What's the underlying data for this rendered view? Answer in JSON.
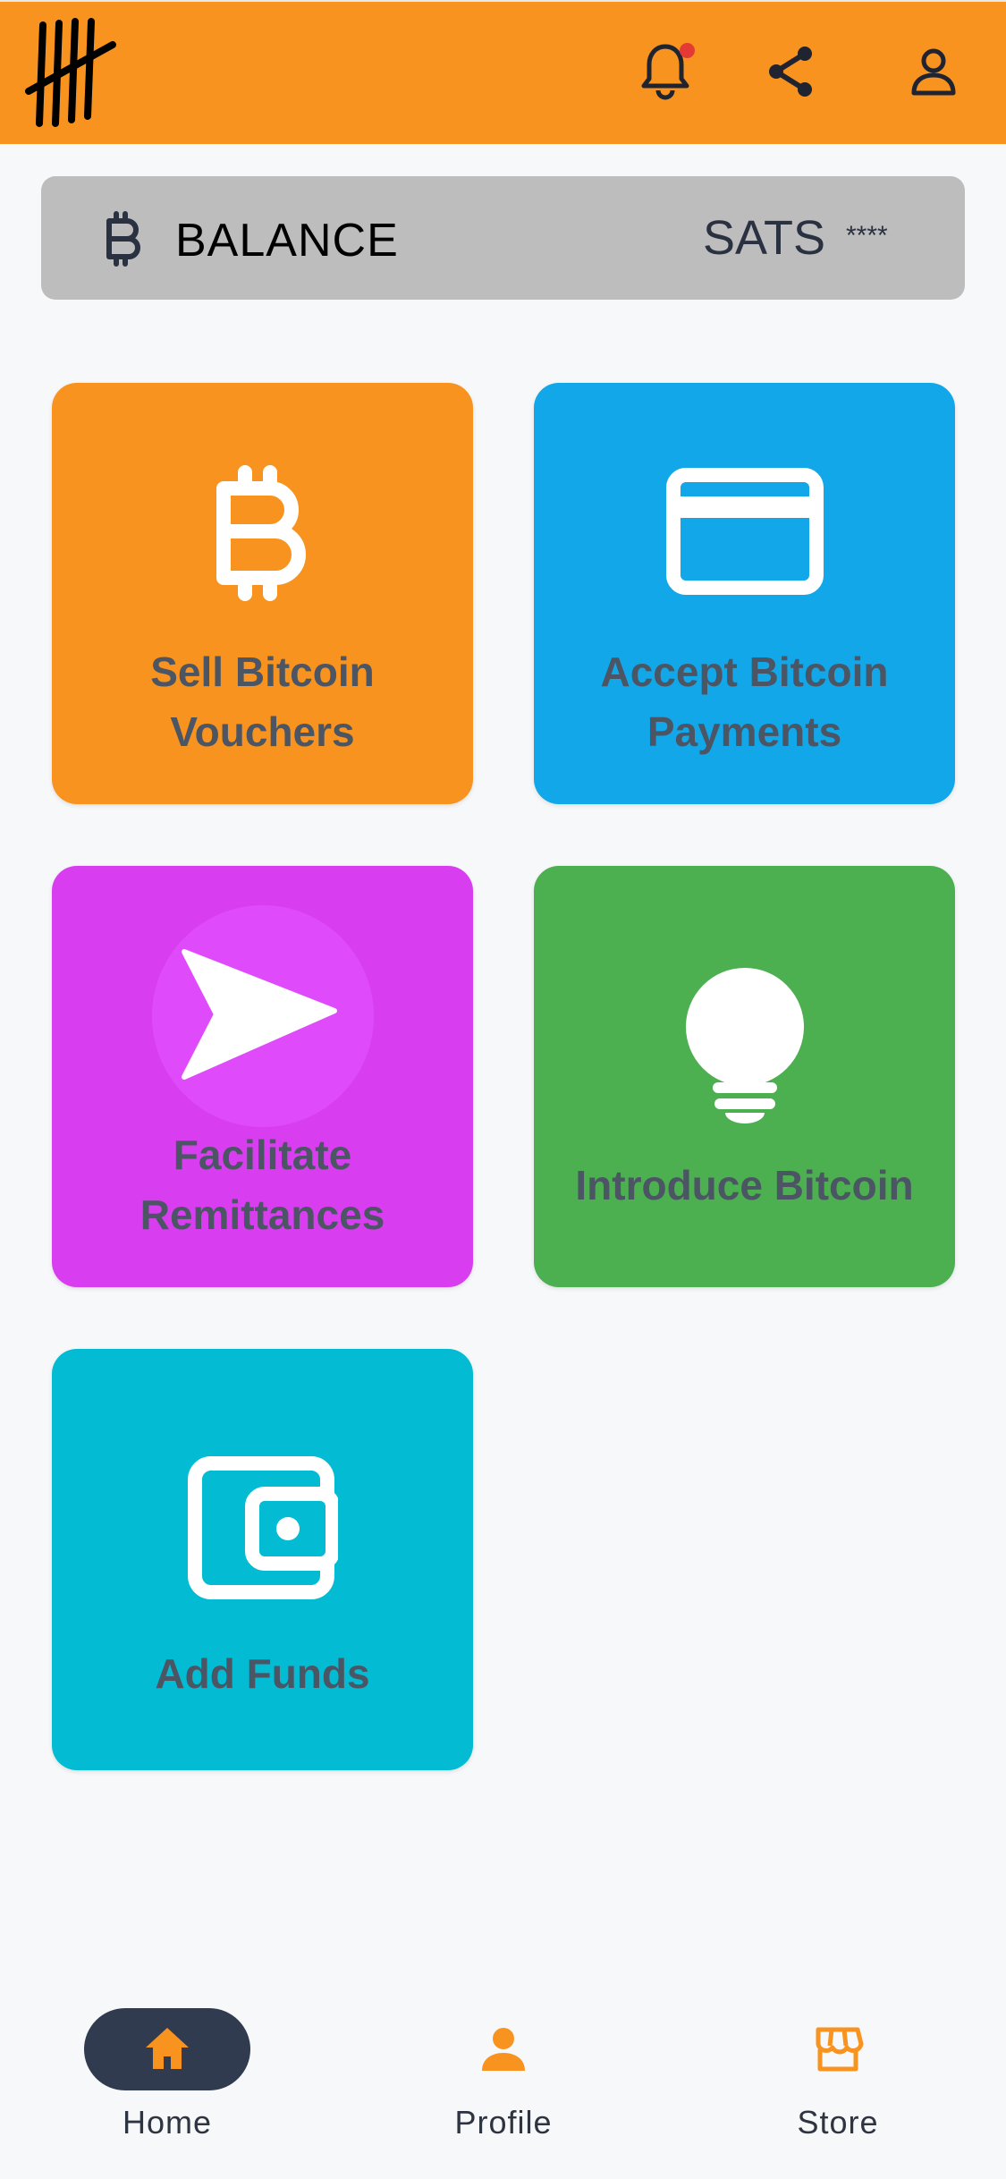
{
  "colors": {
    "topbar": "#F7931E",
    "accent": "#F7931E",
    "notification_dot": "#E53935",
    "sell_tile": "#F7931E",
    "accept_tile": "#12A7E8",
    "remit_tile": "#D83EF0",
    "intro_tile": "#4CAF50",
    "funds_tile": "#03BBD3",
    "active_pill": "#303B4F"
  },
  "header": {
    "logo": "tally-marks-logo",
    "icons": [
      "bell-icon",
      "share-icon",
      "user-icon"
    ]
  },
  "balance": {
    "label": "BALANCE",
    "unit": "SATS",
    "value": "****"
  },
  "tiles": [
    {
      "label_line1": "Sell Bitcoin",
      "label_line2": "Vouchers",
      "icon": "bitcoin-icon"
    },
    {
      "label_line1": "Accept Bitcoin",
      "label_line2": "Payments",
      "icon": "credit-card-icon"
    },
    {
      "label_line1": "Facilitate",
      "label_line2": "Remittances",
      "icon": "send-icon"
    },
    {
      "label_line1": "Introduce Bitcoin",
      "icon": "lightbulb-icon"
    },
    {
      "label_line1": "Add Funds",
      "icon": "wallet-icon"
    }
  ],
  "nav": {
    "items": [
      {
        "label": "Home",
        "icon": "home-icon",
        "active": true
      },
      {
        "label": "Profile",
        "icon": "profile-icon",
        "active": false
      },
      {
        "label": "Store",
        "icon": "store-icon",
        "active": false
      }
    ]
  }
}
